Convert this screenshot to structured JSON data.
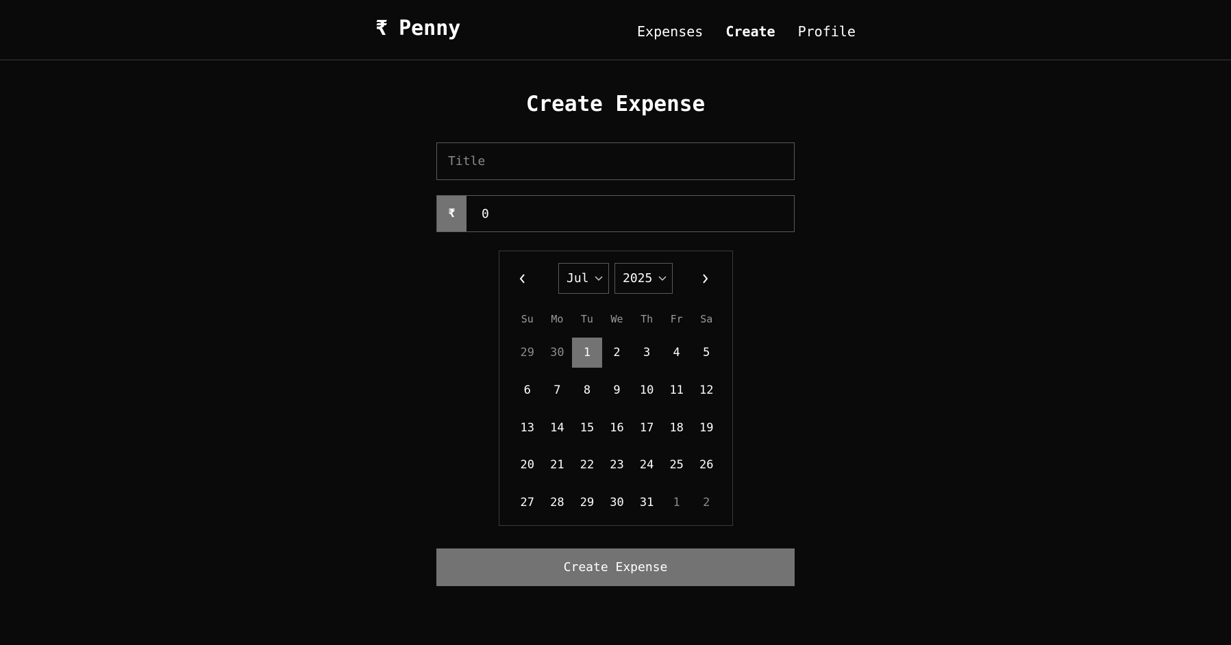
{
  "brand": {
    "symbol": "₹",
    "name": "Penny"
  },
  "nav": {
    "items": [
      {
        "label": "Expenses",
        "active": false
      },
      {
        "label": "Create",
        "active": true
      },
      {
        "label": "Profile",
        "active": false
      }
    ]
  },
  "page": {
    "title": "Create Expense"
  },
  "form": {
    "title_placeholder": "Title",
    "title_value": "",
    "currency_symbol": "₹",
    "amount_value": "0",
    "submit_label": "Create Expense"
  },
  "calendar": {
    "month": "Jul",
    "year": "2025",
    "prev_icon": "chevron-left-icon",
    "next_icon": "chevron-right-icon",
    "weekdays": [
      "Su",
      "Mo",
      "Tu",
      "We",
      "Th",
      "Fr",
      "Sa"
    ],
    "weeks": [
      [
        {
          "d": "29",
          "out": true
        },
        {
          "d": "30",
          "out": true
        },
        {
          "d": "1",
          "sel": true
        },
        {
          "d": "2"
        },
        {
          "d": "3"
        },
        {
          "d": "4"
        },
        {
          "d": "5"
        }
      ],
      [
        {
          "d": "6"
        },
        {
          "d": "7"
        },
        {
          "d": "8"
        },
        {
          "d": "9"
        },
        {
          "d": "10"
        },
        {
          "d": "11"
        },
        {
          "d": "12"
        }
      ],
      [
        {
          "d": "13"
        },
        {
          "d": "14"
        },
        {
          "d": "15"
        },
        {
          "d": "16"
        },
        {
          "d": "17"
        },
        {
          "d": "18"
        },
        {
          "d": "19"
        }
      ],
      [
        {
          "d": "20"
        },
        {
          "d": "21"
        },
        {
          "d": "22"
        },
        {
          "d": "23"
        },
        {
          "d": "24"
        },
        {
          "d": "25"
        },
        {
          "d": "26"
        }
      ],
      [
        {
          "d": "27"
        },
        {
          "d": "28"
        },
        {
          "d": "29"
        },
        {
          "d": "30"
        },
        {
          "d": "31"
        },
        {
          "d": "1",
          "out": true
        },
        {
          "d": "2",
          "out": true
        }
      ]
    ]
  },
  "colors": {
    "background": "#0a0a0a",
    "accent": "#737373",
    "border": "#5a5a5a",
    "muted_text": "#8a8a8a"
  }
}
